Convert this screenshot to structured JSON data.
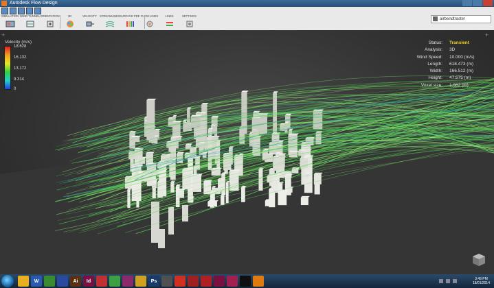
{
  "window": {
    "title": "Autodesk Flow Design"
  },
  "ribbon": {
    "tabs": [
      "SIMULATION",
      "WIND TUNNEL",
      "ORIENTATION",
      "3D",
      "VELOCITY",
      "STREAMLINES",
      "SURFACE PRESSURE",
      "FLOW LINES",
      "LINES",
      "SETTINGS"
    ],
    "tools": [
      {
        "icon": "simulation-icon"
      },
      {
        "icon": "wind-tunnel-icon"
      },
      {
        "icon": "orientation-icon"
      },
      {
        "icon": "3d-view-icon"
      },
      {
        "icon": "velocity-icon"
      },
      {
        "icon": "streamlines-icon"
      },
      {
        "icon": "surface-pressure-icon"
      },
      {
        "icon": "flow-lines-icon"
      },
      {
        "icon": "lines-icon"
      },
      {
        "icon": "settings-icon"
      }
    ],
    "user": "airbendtraster"
  },
  "legend": {
    "title": "Velocity (m/s)",
    "ticks": [
      "18.628",
      "16.132",
      "13.172",
      "9.314",
      "0"
    ]
  },
  "info": {
    "rows": [
      {
        "key": "Status:",
        "value": "Transient",
        "highlight": true
      },
      {
        "key": "Analysis:",
        "value": "3D"
      },
      {
        "key": "Wind Speed:",
        "value": "10.000 (m/s)"
      },
      {
        "key": "Length:",
        "value": "618.473 (m)"
      },
      {
        "key": "Width:",
        "value": "166.512 (m)"
      },
      {
        "key": "Height:",
        "value": "47.575 (m)"
      },
      {
        "key": "Voxel size:",
        "value": "1.982 (m)"
      }
    ]
  },
  "taskbar": {
    "apps": [
      {
        "label": "",
        "color": "#e8b020"
      },
      {
        "label": "W",
        "color": "#2a5ab0"
      },
      {
        "label": "",
        "color": "#3a8a30"
      },
      {
        "label": "",
        "color": "#2a4aa0"
      },
      {
        "label": "Ai",
        "color": "#5a3010"
      },
      {
        "label": "Id",
        "color": "#7a1040"
      },
      {
        "label": "",
        "color": "#c03030"
      },
      {
        "label": "",
        "color": "#3aa040"
      },
      {
        "label": "",
        "color": "#8a2a6a"
      },
      {
        "label": "",
        "color": "#d0a020"
      },
      {
        "label": "Ps",
        "color": "#1a3a6a"
      },
      {
        "label": "",
        "color": "#505050"
      },
      {
        "label": "",
        "color": "#d03020"
      },
      {
        "label": "",
        "color": "#a02020"
      },
      {
        "label": "",
        "color": "#b02020"
      },
      {
        "label": "",
        "color": "#7a1040"
      },
      {
        "label": "",
        "color": "#a02050"
      },
      {
        "label": "",
        "color": "#101010"
      },
      {
        "label": "",
        "color": "#e07a10"
      }
    ],
    "time": "3:49 PM",
    "date": "18/01/2014"
  },
  "colors": {
    "status_highlight": "#f0d020",
    "streamline": "#5ad050"
  }
}
